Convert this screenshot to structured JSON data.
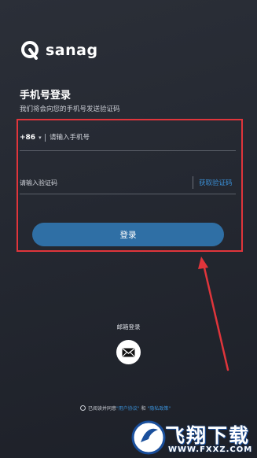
{
  "brand": {
    "name": "sanag",
    "logo_icon": "sanag-logo-icon"
  },
  "login": {
    "title": "手机号登录",
    "subtitle": "我们将会向您的手机号发送验证码",
    "country_code": "+86",
    "caret": "▾",
    "phone_placeholder": "请输入手机号",
    "code_placeholder": "请输入验证码",
    "get_code_label": "获取验证码",
    "submit_label": "登录"
  },
  "alt_login": {
    "email_label": "邮箱登录",
    "email_icon": "mail-icon"
  },
  "agreement": {
    "prefix": "已阅读并同意",
    "user_agreement": "\"用户协议\"",
    "and": "和",
    "privacy_policy": "\"隐私政策\""
  },
  "watermark": {
    "text": "飞翔下载",
    "url": "WWW.FXXZ.COM"
  },
  "colors": {
    "accent": "#3a8fd6",
    "button": "#2f6fa5",
    "highlight_box": "#e0353b",
    "background": "#252932"
  }
}
